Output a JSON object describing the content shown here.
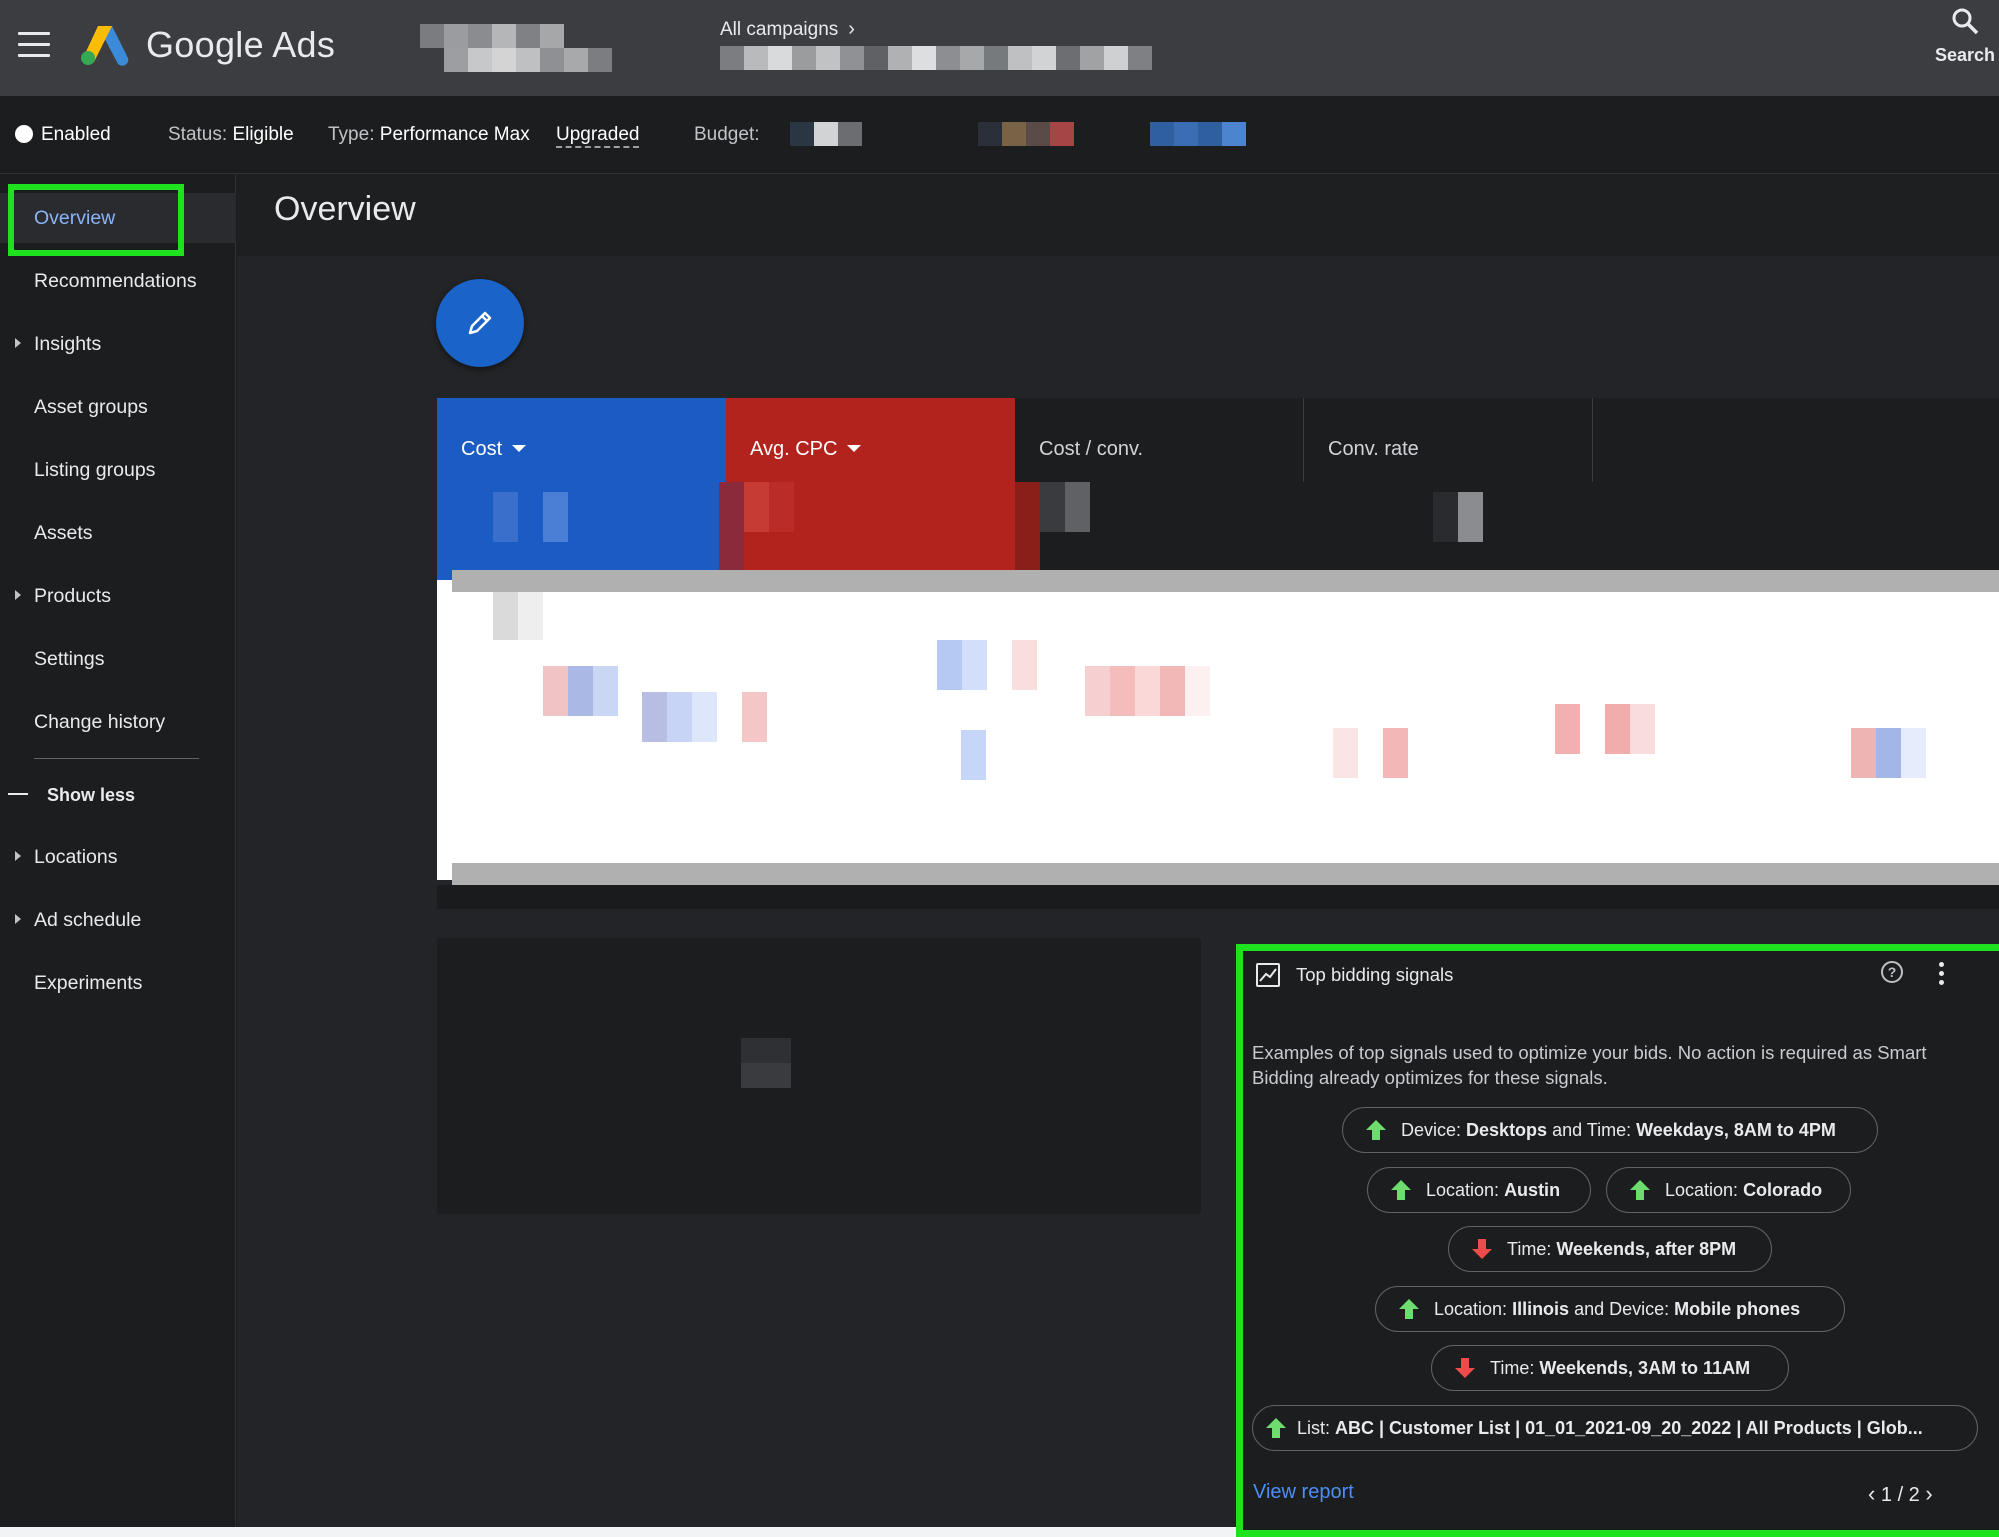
{
  "header": {
    "brand": "Google Ads",
    "breadcrumb": "All campaigns",
    "search_label": "Search"
  },
  "status_bar": {
    "enabled": "Enabled",
    "status_key": "Status:",
    "status_val": "Eligible",
    "type_key": "Type:",
    "type_val": "Performance Max",
    "upgraded": "Upgraded",
    "budget_key": "Budget:"
  },
  "sidebar": {
    "items": [
      {
        "label": "Overview"
      },
      {
        "label": "Recommendations"
      },
      {
        "label": "Insights"
      },
      {
        "label": "Asset groups"
      },
      {
        "label": "Listing groups"
      },
      {
        "label": "Assets"
      },
      {
        "label": "Products"
      },
      {
        "label": "Settings"
      },
      {
        "label": "Change history"
      }
    ],
    "show_less": "Show less",
    "extra_items": [
      {
        "label": "Locations"
      },
      {
        "label": "Ad schedule"
      },
      {
        "label": "Experiments"
      }
    ]
  },
  "main": {
    "title": "Overview",
    "metrics": [
      {
        "label": "Cost",
        "color": "#1b5bc4"
      },
      {
        "label": "Avg. CPC",
        "color": "#b3231d"
      },
      {
        "label": "Cost / conv."
      },
      {
        "label": "Conv. rate"
      }
    ]
  },
  "bidding": {
    "title": "Top bidding signals",
    "description": "Examples of top signals used to optimize your bids. No action is required as Smart Bidding already optimizes for these signals.",
    "signals": [
      {
        "direction": "up",
        "k1": "Device: ",
        "v1": "Desktops",
        "k2": " and Time: ",
        "v2": "Weekdays, 8AM to 4PM"
      },
      {
        "direction": "up",
        "k1": "Location: ",
        "v1": "Austin",
        "k2": "",
        "v2": ""
      },
      {
        "direction": "up",
        "k1": "Location: ",
        "v1": "Colorado",
        "k2": "",
        "v2": ""
      },
      {
        "direction": "down",
        "k1": "Time: ",
        "v1": "Weekends, after 8PM",
        "k2": "",
        "v2": ""
      },
      {
        "direction": "up",
        "k1": "Location: ",
        "v1": "Illinois",
        "k2": " and Device: ",
        "v2": "Mobile phones"
      },
      {
        "direction": "down",
        "k1": "Time: ",
        "v1": "Weekends, 3AM to 11AM",
        "k2": "",
        "v2": ""
      },
      {
        "direction": "up",
        "k1": "List: ",
        "v1": "ABC | Customer List | 01_01_2021-09_20_2022 | All Products | Glob...",
        "k2": "",
        "v2": ""
      }
    ],
    "view_report": "View report",
    "pager": "1 / 2",
    "up_color": "#6fdc6f",
    "down_color": "#ee4b4b"
  }
}
